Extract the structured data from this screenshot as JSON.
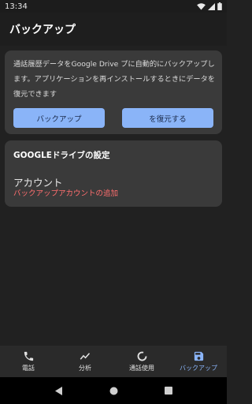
{
  "status_bar": {
    "time": "13:34"
  },
  "app_bar": {
    "title": "バックアップ"
  },
  "backup_card": {
    "description": "通話履歴データをGoogle Drive プに自動的にバックアップします。アプリケーションを再インストールするときにデータを復元できます",
    "backup_button": "バックアップ",
    "restore_button": "を復元する"
  },
  "drive_card": {
    "title": "GOOGLEドライブの設定",
    "account_label": "アカウント",
    "add_account": "バックアップアカウントの追加"
  },
  "bottom_nav": {
    "items": [
      {
        "label": "電話",
        "icon": "phone-icon"
      },
      {
        "label": "分析",
        "icon": "trend-icon"
      },
      {
        "label": "通話使用",
        "icon": "usage-icon"
      },
      {
        "label": "バックアップ",
        "icon": "save-icon",
        "active": true
      }
    ]
  },
  "colors": {
    "accent": "#8ab4f8",
    "warning_text": "#ff6e6e",
    "card_bg": "#3a3a3a",
    "page_bg": "#212121"
  }
}
